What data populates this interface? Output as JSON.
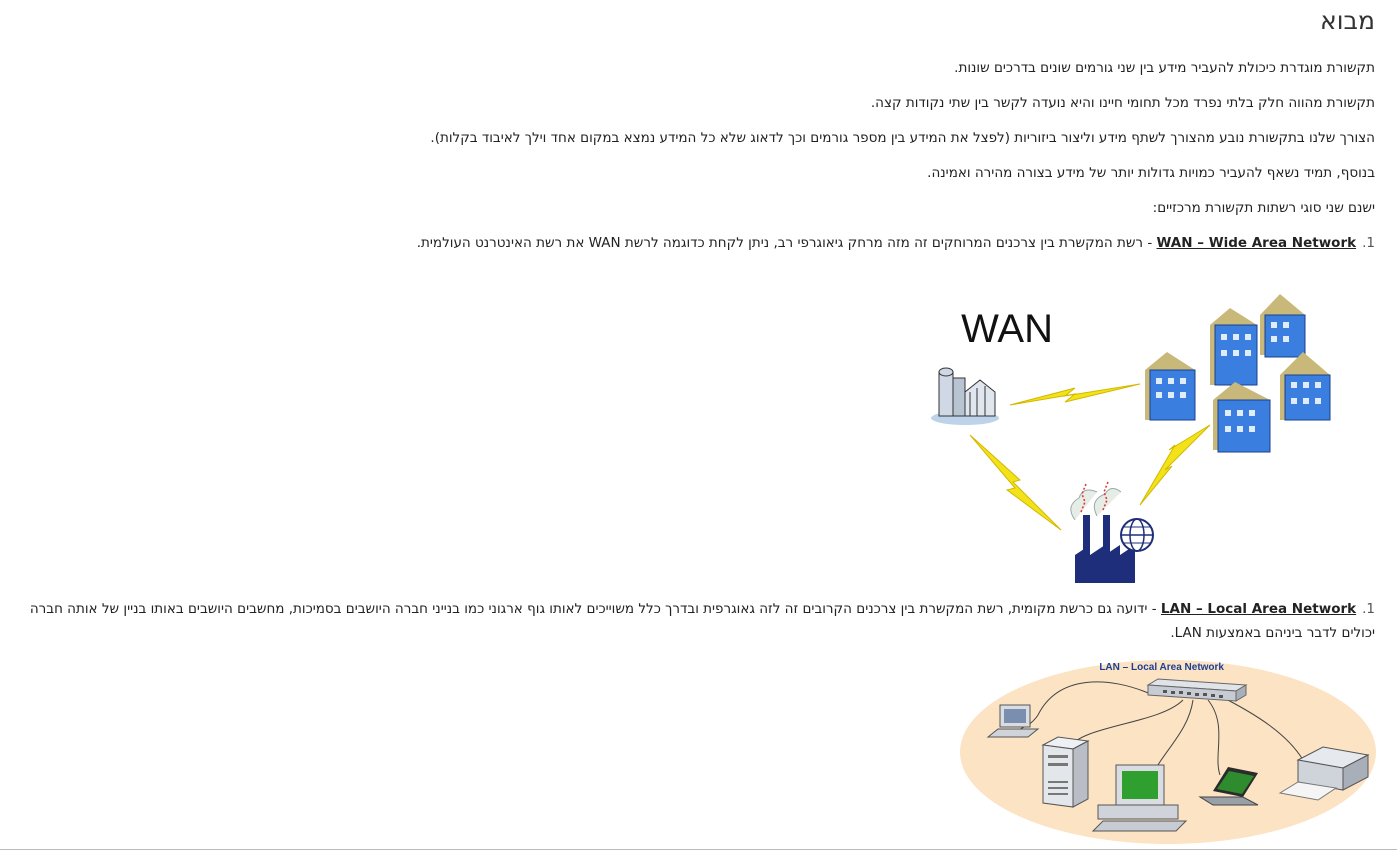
{
  "heading": "מבוא",
  "paragraphs": [
    "תקשורת מוגדרת כיכולת להעביר מידע בין שני גורמים שונים בדרכים שונות.",
    "תקשורת מהווה חלק בלתי נפרד מכל תחומי חיינו והיא נועדה לקשר בין שתי נקודות קצה.",
    "הצורך שלנו בתקשורת נובע מהצורך לשתף מידע וליצור ביזוריות (לפצל את המידע בין מספר גורמים וכך לדאוג שלא כל המידע נמצא במקום אחד וילך לאיבוד בקלות).",
    "בנוסף, תמיד נשאף להעביר כמויות גדולות יותר של מידע בצורה מהירה ואמינה.",
    "ישנם שני סוגי רשתות תקשורת מרכזיים:"
  ],
  "list": [
    {
      "number": "1.",
      "term": "WAN – Wide Area Network",
      "separator": " - ",
      "text": "רשת המקשרת בין צרכנים המרוחקים זה מזה מרחק גיאוגרפי רב, ניתן לקחת כדוגמה לרשת WAN את רשת האינטרנט העולמית."
    },
    {
      "number": "1.",
      "term": "LAN – Local Area Network",
      "separator": " - ",
      "text": "ידועה גם כרשת מקומית, רשת המקשרת בין צרכנים הקרובים זה לזה גאוגרפית ובדרך כלל משוייכים לאותו גוף ארגוני כמו בנייני חברה היושבים בסמיכות, מחשבים היושבים באותו בניין של אותה חברה יכולים לדבר ביניהם באמצעות LAN."
    }
  ],
  "wan_figure": {
    "label": "WAN"
  },
  "lan_figure": {
    "label": "LAN – Local Area Network"
  },
  "colors": {
    "building_blue": "#3a7fe0",
    "building_tan": "#c8b87a",
    "lightning": "#f2e21a",
    "factory": "#1e2e7a",
    "lan_ellipse": "#fbe3c4",
    "lan_title": "#1c3f95"
  }
}
